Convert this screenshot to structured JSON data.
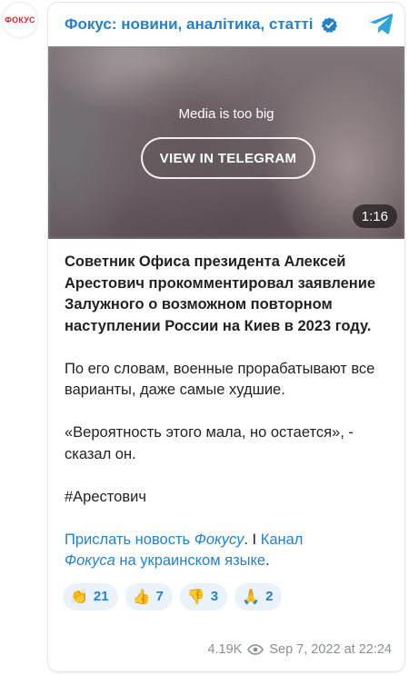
{
  "channel": {
    "avatar_text": "ФОКУС",
    "title": "Фокус: новини, аналітика, статті",
    "verified_icon": "verified-badge-icon",
    "telegram_icon": "telegram-plane-icon",
    "accent_color": "#2481cc",
    "brand_color": "#e5202c"
  },
  "media": {
    "notice": "Media is too big",
    "button_label": "VIEW IN TELEGRAM",
    "duration": "1:16"
  },
  "post": {
    "headline": "Советник Офиса президента Алексей Арестович прокомментировал заявление Залужного о возможном повторном наступлении России на Киев в 2023 году.",
    "paragraph_2": "По его словам, военные прорабатывают все варианты, даже самые худшие.",
    "paragraph_3": "«Вероятность этого мала, но остается», - сказал он.",
    "hashtag": "#Арестович",
    "link_1_prefix": "Прислать новость ",
    "link_1_italic": "Фокусу",
    "separator": ". I ",
    "link_2_prefix": "Канал",
    "link_2_italic": "Фокуса",
    "link_2_suffix": " на украинском языке",
    "end": "."
  },
  "reactions": [
    {
      "emoji": "👏",
      "icon": "clapping-hands-icon",
      "count": "21"
    },
    {
      "emoji": "👍",
      "icon": "thumbs-up-icon",
      "count": "7"
    },
    {
      "emoji": "👎",
      "icon": "thumbs-down-icon",
      "count": "3"
    },
    {
      "emoji": "🙏",
      "icon": "folded-hands-icon",
      "count": "2"
    }
  ],
  "footer": {
    "views": "4.19K",
    "views_icon": "eye-icon",
    "timestamp": "Sep 7, 2022 at 22:24"
  }
}
